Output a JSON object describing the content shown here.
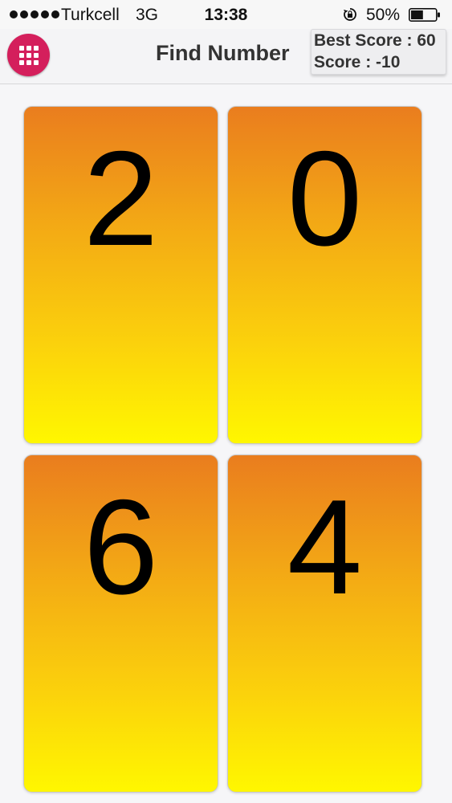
{
  "status_bar": {
    "carrier": "Turkcell",
    "network": "3G",
    "time": "13:38",
    "battery": "50%",
    "signal_icon": "signal-dots-icon",
    "lock_icon": "rotation-lock-icon",
    "battery_icon": "battery-icon",
    "battery_level": 0.5
  },
  "header": {
    "menu_icon": "grid-icon",
    "menu_color": "#d41f5c",
    "title": "Find Number",
    "best_score": "Best Score : 60",
    "score": "Score : -10"
  },
  "cards": [
    {
      "number": "2"
    },
    {
      "number": "0"
    },
    {
      "number": "6"
    },
    {
      "number": "4"
    }
  ],
  "colors": {
    "card_top": "#ea7d1e",
    "card_bottom": "#fff700"
  }
}
